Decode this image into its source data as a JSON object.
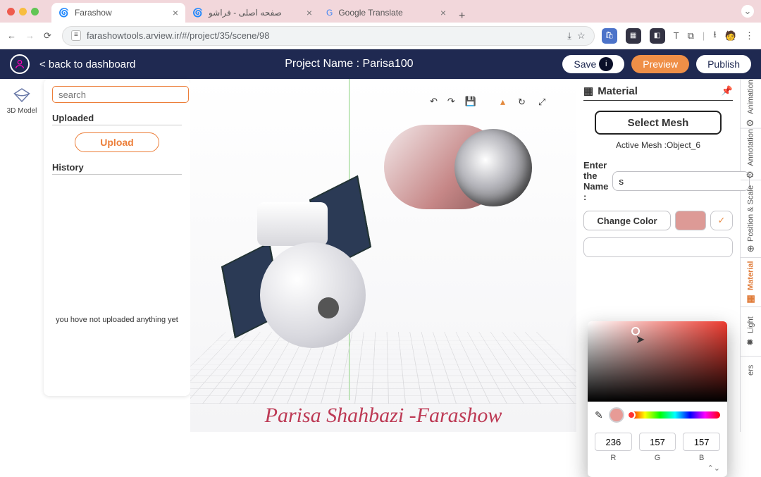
{
  "browser": {
    "tabs": [
      {
        "title": "Farashow"
      },
      {
        "title": "صفحه اصلی - فراشو"
      },
      {
        "title": "Google Translate"
      }
    ],
    "url": "farashowtools.arview.ir/#/project/35/scene/98"
  },
  "app_bar": {
    "back": "< back to dashboard",
    "project_label": "Project Name : Parisa100",
    "save": "Save",
    "preview": "Preview",
    "publish": "Publish"
  },
  "left_rail": {
    "model_label": "3D Model"
  },
  "asset_panel": {
    "search_placeholder": "search",
    "uploaded_header": "Uploaded",
    "upload_btn": "Upload",
    "history_header": "History",
    "empty_msg": "you hove not uploaded anything yet"
  },
  "watermark": "Parisa Shahbazi -Farashow",
  "material_panel": {
    "title": "Material",
    "select_mesh": "Select Mesh",
    "active_mesh": "Active Mesh :Object_6",
    "name_label": "Enter the Name :",
    "name_value": "s",
    "change_color": "Change Color",
    "swatch_hex": "#dd9a96"
  },
  "color_picker": {
    "r": "236",
    "g": "157",
    "b": "157",
    "labels": {
      "r": "R",
      "g": "G",
      "b": "B"
    }
  },
  "right_rail": {
    "items": [
      "Animation",
      "Annotation",
      "Position & Scale",
      "Material",
      "Light",
      "ers"
    ]
  }
}
